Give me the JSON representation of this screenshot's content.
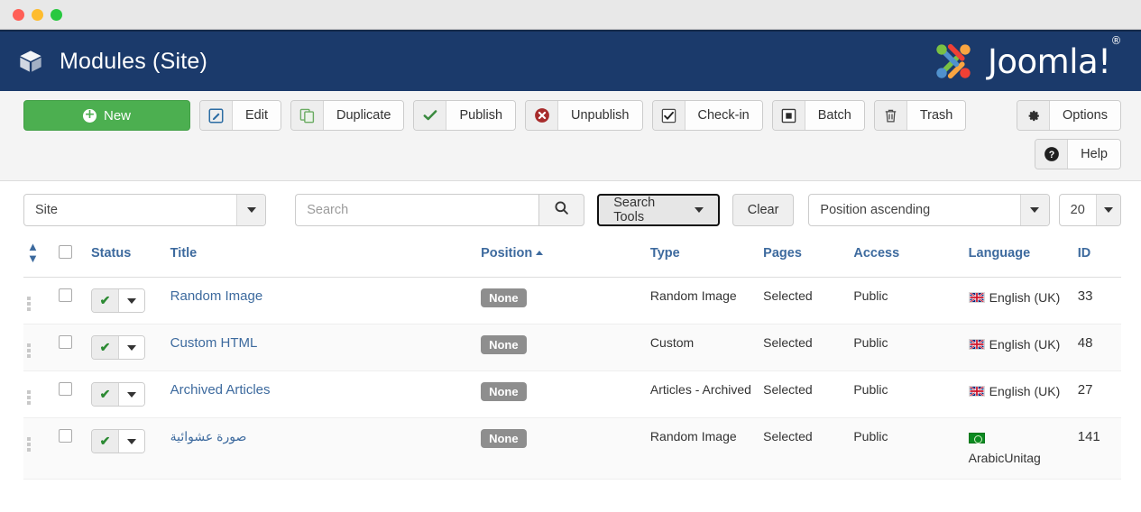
{
  "window": {
    "controls": [
      "close",
      "minimize",
      "maximize"
    ]
  },
  "header": {
    "title": "Modules (Site)",
    "icon": "cube-icon",
    "brand": "Joomla!",
    "brand_mark": "®",
    "background_color": "#1b3a6b"
  },
  "toolbar": {
    "new_label": "New",
    "new_color": "#4caf50",
    "buttons": [
      {
        "label": "Edit",
        "icon": "pencil-square-icon"
      },
      {
        "label": "Duplicate",
        "icon": "copy-icon"
      },
      {
        "label": "Publish",
        "icon": "check-icon"
      },
      {
        "label": "Unpublish",
        "icon": "x-circle-icon"
      },
      {
        "label": "Check-in",
        "icon": "checkbox-icon"
      },
      {
        "label": "Batch",
        "icon": "square-inset-icon"
      },
      {
        "label": "Trash",
        "icon": "trash-icon"
      }
    ],
    "options_label": "Options",
    "options_icon": "gear-icon",
    "help_label": "Help",
    "help_icon": "question-circle-icon"
  },
  "filters": {
    "scope_value": "Site",
    "search_placeholder": "Search",
    "search_value": "",
    "search_icon": "magnifier-icon",
    "search_tools_label": "Search Tools",
    "clear_label": "Clear",
    "sort_value": "Position ascending",
    "limit_value": "20"
  },
  "table": {
    "headers": {
      "ordering": "ordering-sort-icon",
      "check_all": "select-all-checkbox",
      "status": "Status",
      "title": "Title",
      "position": "Position",
      "position_sort": "ascending",
      "type": "Type",
      "pages": "Pages",
      "access": "Access",
      "language": "Language",
      "id": "ID"
    },
    "rows": [
      {
        "title": "Random Image",
        "rtl": false,
        "status": "published",
        "position": "None",
        "type": "Random Image",
        "pages": "Selected",
        "access": "Public",
        "language": "English (UK)",
        "language_flag": "uk-flag",
        "id": "33"
      },
      {
        "title": "Custom HTML",
        "rtl": false,
        "status": "published",
        "position": "None",
        "type": "Custom",
        "pages": "Selected",
        "access": "Public",
        "language": "English (UK)",
        "language_flag": "uk-flag",
        "id": "48"
      },
      {
        "title": "Archived Articles",
        "rtl": false,
        "status": "published",
        "position": "None",
        "type": "Articles - Archived",
        "pages": "Selected",
        "access": "Public",
        "language": "English (UK)",
        "language_flag": "uk-flag",
        "id": "27"
      },
      {
        "title": "صورة عشوائية",
        "rtl": true,
        "status": "published",
        "position": "None",
        "type": "Random Image",
        "pages": "Selected",
        "access": "Public",
        "language": "ArabicUnitag",
        "language_flag": "green-flag",
        "id": "141"
      }
    ]
  }
}
